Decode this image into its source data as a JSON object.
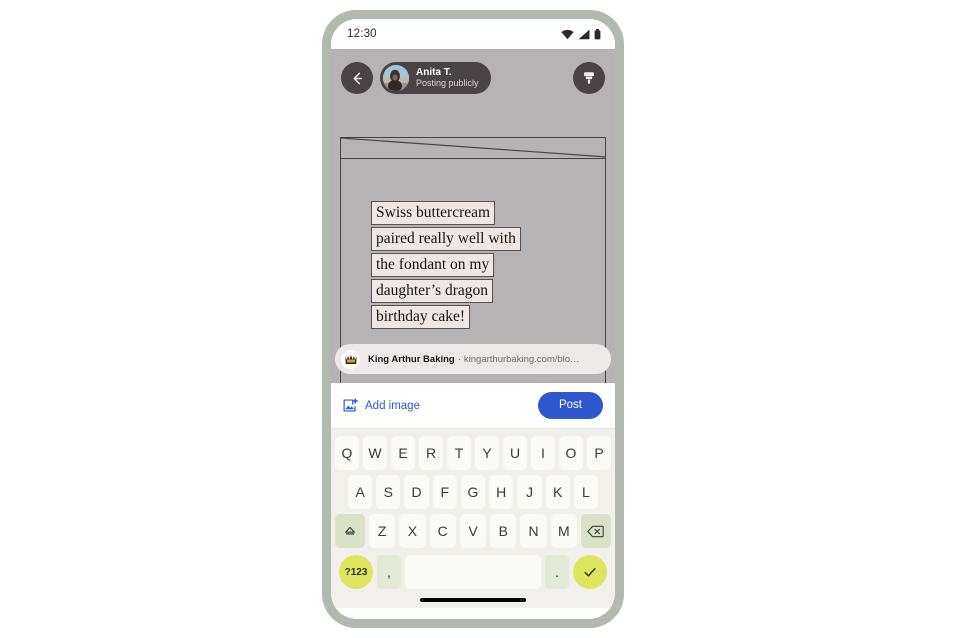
{
  "status_bar": {
    "time": "12:30",
    "icons": [
      "wifi-icon",
      "cellular-signal-icon",
      "battery-icon"
    ]
  },
  "compose_header": {
    "back_icon": "arrow-left-icon",
    "author_name": "Anita T.",
    "visibility": "Posting publicly",
    "edit_icon": "format-brush-icon"
  },
  "post": {
    "lines": [
      "Swiss buttercream",
      "paired really well with",
      "the fondant on my",
      "daughter’s dragon",
      "birthday cake!"
    ],
    "highlight_color": "#efe7e6",
    "outline_color": "#5a5153"
  },
  "link_card": {
    "favicon": "crown-icon",
    "title": "King Arthur Baking",
    "separator": "·",
    "url": "kingarthurbaking.com/blo…"
  },
  "action_bar": {
    "add_image_icon": "add-photo-icon",
    "add_image_label": "Add image",
    "post_label": "Post",
    "accent_color": "#2f57cf"
  },
  "keyboard": {
    "row1": [
      "Q",
      "W",
      "E",
      "R",
      "T",
      "Y",
      "U",
      "I",
      "O",
      "P"
    ],
    "row2": [
      "A",
      "S",
      "D",
      "F",
      "G",
      "H",
      "J",
      "K",
      "L"
    ],
    "row3": [
      "Z",
      "X",
      "C",
      "V",
      "B",
      "N",
      "M"
    ],
    "shift_icon": "shift-up-icon",
    "backspace_icon": "backspace-icon",
    "numeric_label": "?123",
    "comma_label": ",",
    "period_label": ".",
    "space_label": "",
    "enter_icon": "checkmark-icon",
    "mod_key_color": "#d9e1c8",
    "accent_key_color": "#dde55f"
  }
}
